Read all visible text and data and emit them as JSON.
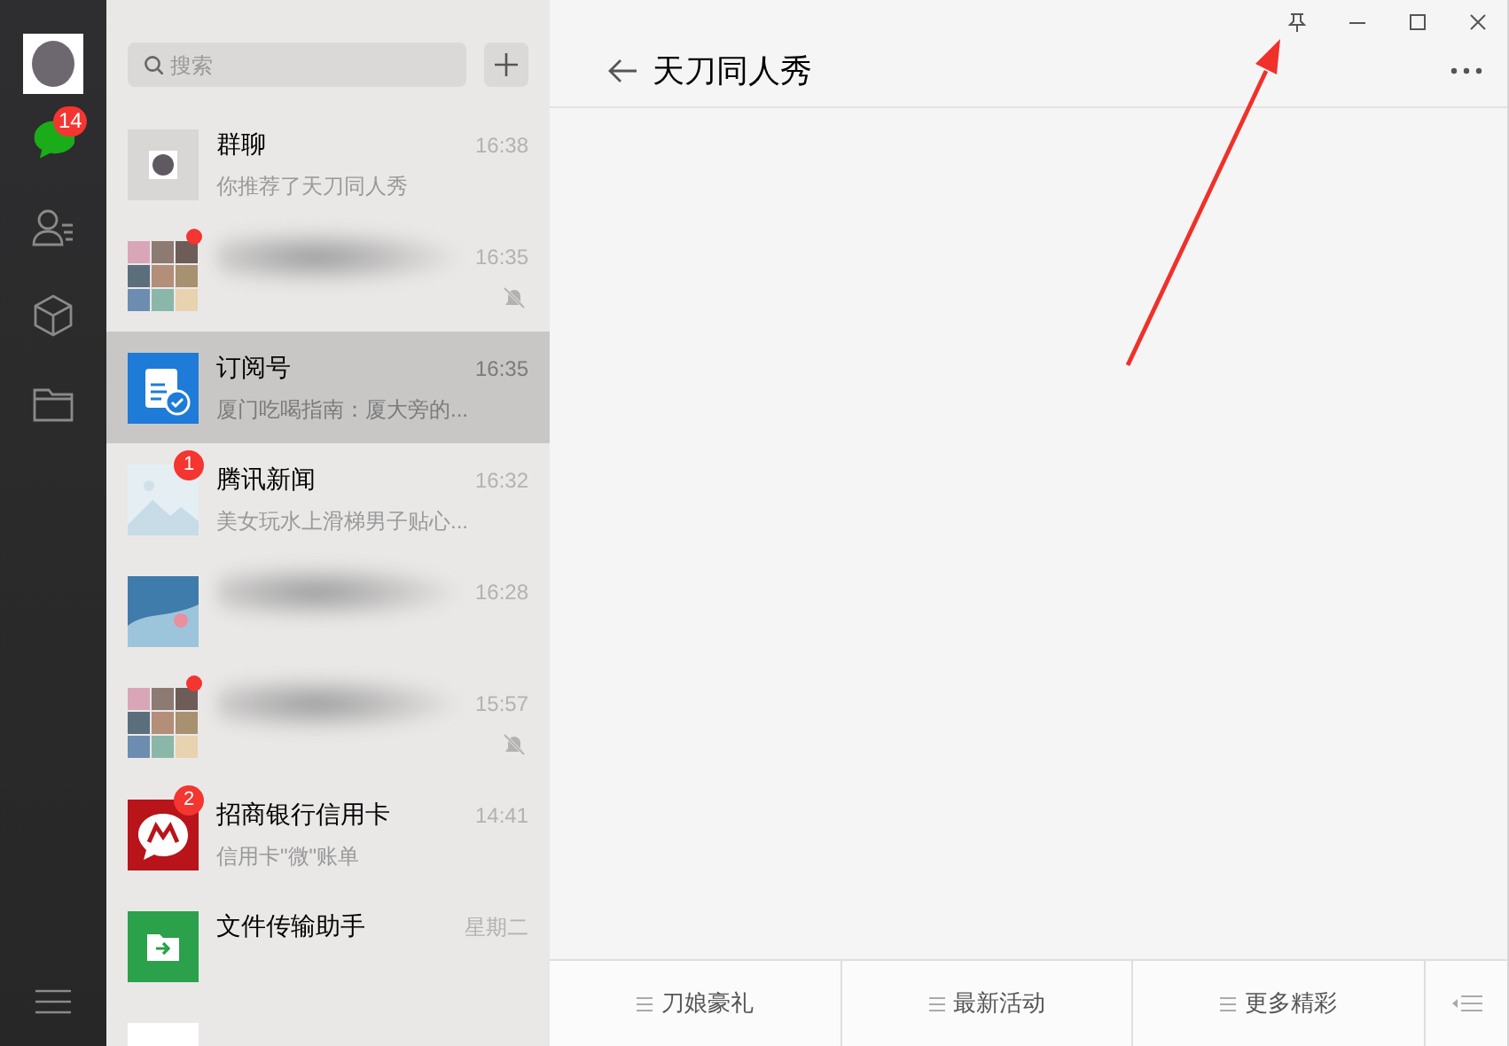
{
  "sidebar": {
    "nav": [
      {
        "kind": "chat",
        "selected": true,
        "badge": "14"
      },
      {
        "kind": "contacts",
        "selected": false
      },
      {
        "kind": "cube",
        "selected": false
      },
      {
        "kind": "folder",
        "selected": false
      }
    ]
  },
  "chat_list": {
    "search": {
      "placeholder": "搜索"
    },
    "chats": [
      {
        "kind": "photo",
        "name": "群聊",
        "preview": "你推荐了天刀同人秀",
        "time": "16:38",
        "blurred": false,
        "muted": false,
        "unread_dot": false,
        "selected": false
      },
      {
        "kind": "grid",
        "time": "16:35",
        "blurred": true,
        "muted": true,
        "unread_dot": true,
        "selected": false
      },
      {
        "kind": "subscription",
        "name": "订阅号",
        "preview": "厦门吃喝指南：厦大旁的...",
        "time": "16:35",
        "blurred": false,
        "muted": false,
        "unread_dot": false,
        "selected": true
      },
      {
        "kind": "news",
        "name": "腾讯新闻",
        "preview": "美女玩水上滑梯男子贴心...",
        "time": "16:32",
        "badge": "1",
        "blurred": false,
        "muted": false,
        "unread_dot": false,
        "selected": false
      },
      {
        "kind": "landscape",
        "time": "16:28",
        "blurred": true,
        "muted": false,
        "unread_dot": false,
        "selected": false
      },
      {
        "kind": "grid",
        "time": "15:57",
        "blurred": true,
        "muted": true,
        "unread_dot": true,
        "selected": false
      },
      {
        "kind": "bank",
        "name": "招商银行信用卡",
        "preview": "信用卡\"微\"账单",
        "time": "14:41",
        "badge": "2",
        "blurred": false,
        "muted": false,
        "unread_dot": false,
        "selected": false
      },
      {
        "kind": "file",
        "name": "文件传输助手",
        "time": "星期二",
        "blurred": false,
        "muted": false,
        "unread_dot": false,
        "selected": false
      },
      {
        "kind": "blank",
        "blurred": false,
        "muted": false,
        "unread_dot": false,
        "selected": false
      }
    ]
  },
  "conversation": {
    "title": "天刀同人秀",
    "menu": [
      "刀娘豪礼",
      "最新活动",
      "更多精彩"
    ]
  }
}
